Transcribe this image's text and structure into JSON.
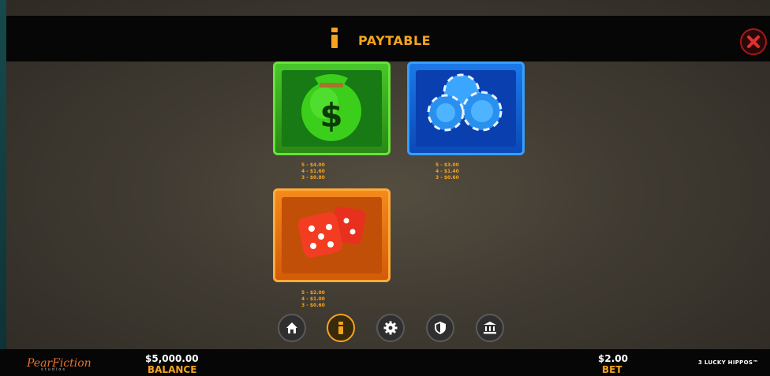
{
  "header": {
    "title": "PAYTABLE"
  },
  "symbols": [
    {
      "name": "money-bag",
      "payouts": [
        "5 - $4.00",
        "4 - $1.60",
        "3 - $0.80"
      ]
    },
    {
      "name": "poker-chips",
      "payouts": [
        "5 - $3.00",
        "4 - $1.40",
        "3 - $0.60"
      ]
    },
    {
      "name": "dice",
      "payouts": [
        "5 - $2.00",
        "4 - $1.00",
        "3 - $0.60"
      ]
    }
  ],
  "nav": {
    "items": [
      {
        "icon": "home-icon"
      },
      {
        "icon": "info-icon",
        "active": true
      },
      {
        "icon": "gear-icon"
      },
      {
        "icon": "shield-icon"
      },
      {
        "icon": "bank-icon"
      }
    ]
  },
  "footer": {
    "logo": "PearFiction",
    "logo_sub": "studios",
    "balance_value": "$5,000.00",
    "balance_label": "BALANCE",
    "bet_value": "$2.00",
    "bet_label": "BET",
    "game_name": "3 LUCKY HIPPOS™"
  },
  "colors": {
    "accent": "#f5a41e",
    "close": "#c21d1d",
    "header_bg": "#060606"
  }
}
